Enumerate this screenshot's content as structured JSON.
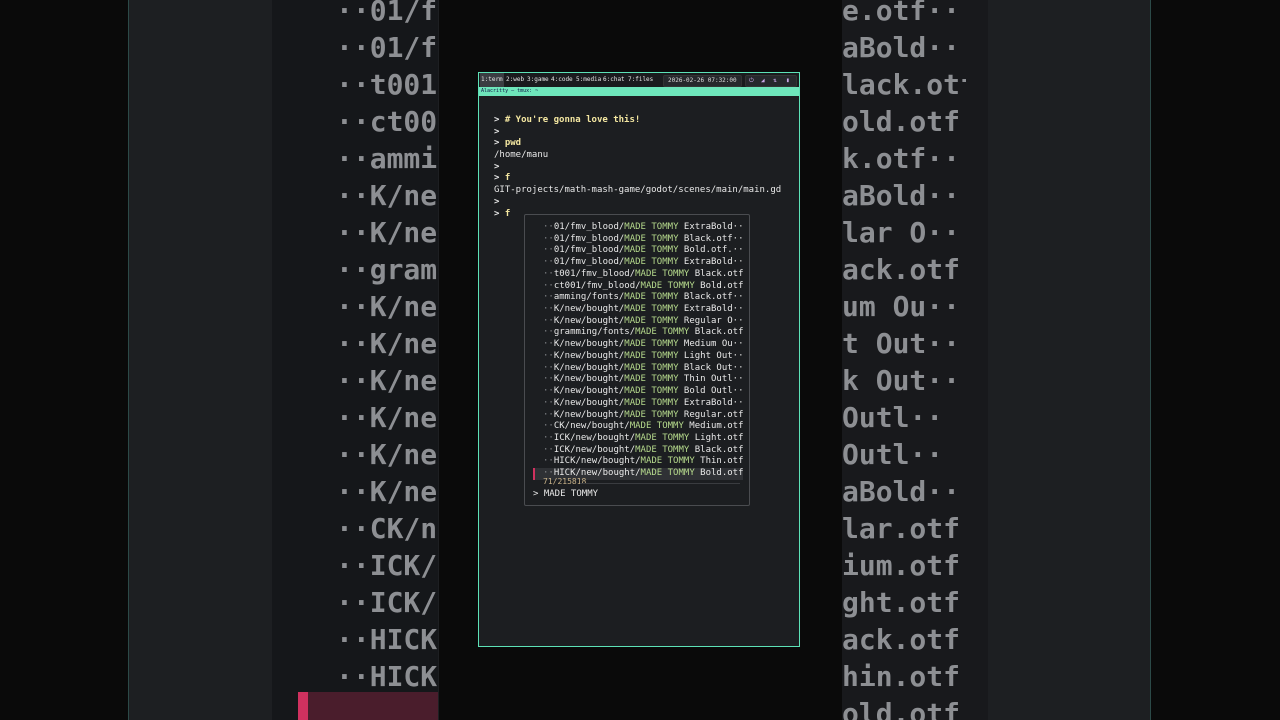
{
  "backdrop": {
    "left_rows": [
      "··01/f",
      "··01/f",
      "··t001",
      "··ct00",
      "··ammi",
      "··K/ne",
      "··K/ne",
      "··gram",
      "··K/ne",
      "··K/ne",
      "··K/ne",
      "··K/ne",
      "··K/ne",
      "··K/ne",
      "··CK/n",
      "··ICK/",
      "··ICK/",
      "··HICK",
      "··HICK"
    ],
    "right_rows": [
      "e.otf··",
      "aBold··",
      "lack.otf",
      "old.otf",
      "k.otf··",
      "aBold··",
      "lar O··",
      "ack.otf",
      "um Ou··",
      "t Out··",
      "k Out··",
      "Outl··",
      "Outl··",
      "aBold··",
      "lar.otf",
      "ium.otf",
      "ght.otf",
      "ack.otf",
      "hin.otf",
      "old.otf"
    ]
  },
  "topbar": {
    "workspaces": [
      "1:term",
      "2:web",
      "3:game",
      "4:code",
      "5:media",
      "6:chat",
      "7:files"
    ],
    "clock": "2026-02-26 07:32:00"
  },
  "titlebar": {
    "text": "Alacritty — tmux: ~"
  },
  "terminal": {
    "prompt": ">",
    "lines": [
      {
        "type": "cmd",
        "text": "# You're gonna love this!"
      },
      {
        "type": "prompt",
        "text": ""
      },
      {
        "type": "cmd",
        "text": "pwd"
      },
      {
        "type": "out",
        "text": "/home/manu"
      },
      {
        "type": "prompt",
        "text": ""
      },
      {
        "type": "cmd",
        "text": "f"
      },
      {
        "type": "out",
        "text": "GIT-projects/math-mash-game/godot/scenes/main/main.gd"
      },
      {
        "type": "prompt",
        "text": ""
      },
      {
        "type": "cmd",
        "text": "f"
      }
    ]
  },
  "fzf": {
    "items": [
      {
        "pre": "··01/fmv_blood/",
        "match": "MADE TOMMY",
        "post": " ExtraBold··"
      },
      {
        "pre": "··01/fmv_blood/",
        "match": "MADE TOMMY",
        "post": " Black.otf··"
      },
      {
        "pre": "··01/fmv_blood/",
        "match": "MADE TOMMY",
        "post": " Bold.otf.··"
      },
      {
        "pre": "··01/fmv_blood/",
        "match": "MADE TOMMY",
        "post": " ExtraBold··"
      },
      {
        "pre": "··t001/fmv_blood/",
        "match": "MADE TOMMY",
        "post": " Black.otf"
      },
      {
        "pre": "··ct001/fmv_blood/",
        "match": "MADE TOMMY",
        "post": " Bold.otf"
      },
      {
        "pre": "··amming/fonts/",
        "match": "MADE TOMMY",
        "post": " Black.otf··"
      },
      {
        "pre": "··K/new/bought/",
        "match": "MADE TOMMY",
        "post": " ExtraBold··"
      },
      {
        "pre": "··K/new/bought/",
        "match": "MADE TOMMY",
        "post": " Regular O··"
      },
      {
        "pre": "··gramming/fonts/",
        "match": "MADE TOMMY",
        "post": " Black.otf"
      },
      {
        "pre": "··K/new/bought/",
        "match": "MADE TOMMY",
        "post": " Medium Ou··"
      },
      {
        "pre": "··K/new/bought/",
        "match": "MADE TOMMY",
        "post": " Light Out··"
      },
      {
        "pre": "··K/new/bought/",
        "match": "MADE TOMMY",
        "post": " Black Out··"
      },
      {
        "pre": "··K/new/bought/",
        "match": "MADE TOMMY",
        "post": " Thin Outl··"
      },
      {
        "pre": "··K/new/bought/",
        "match": "MADE TOMMY",
        "post": " Bold Outl··"
      },
      {
        "pre": "··K/new/bought/",
        "match": "MADE TOMMY",
        "post": " ExtraBold··"
      },
      {
        "pre": "··K/new/bought/",
        "match": "MADE TOMMY",
        "post": " Regular.otf"
      },
      {
        "pre": "··CK/new/bought/",
        "match": "MADE TOMMY",
        "post": " Medium.otf"
      },
      {
        "pre": "··ICK/new/bought/",
        "match": "MADE TOMMY",
        "post": " Light.otf"
      },
      {
        "pre": "··ICK/new/bought/",
        "match": "MADE TOMMY",
        "post": " Black.otf"
      },
      {
        "pre": "··HICK/new/bought/",
        "match": "MADE TOMMY",
        "post": " Thin.otf"
      },
      {
        "pre": "··HICK/new/bought/",
        "match": "MADE TOMMY",
        "post": " Bold.otf",
        "selected": true
      }
    ],
    "counter": "71/215818",
    "query_prompt": ">",
    "query": "MADE TOMMY"
  },
  "colors": {
    "accent": "#5de2b7",
    "match": "#b5d98c",
    "selection_bar": "#d0315f",
    "command": "#f4e7a1"
  }
}
